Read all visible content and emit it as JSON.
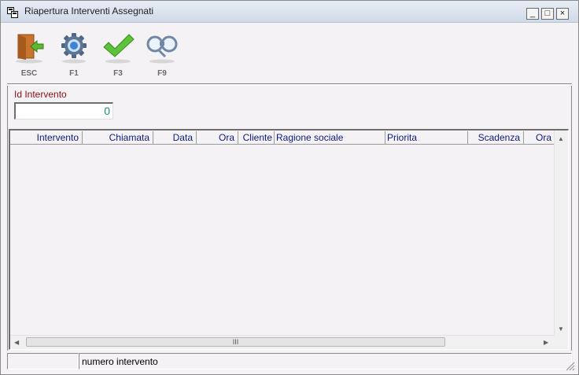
{
  "window": {
    "title": "Riapertura Interventi Assegnati",
    "controls": {
      "minimize": "_",
      "maximize": "□",
      "close": "×"
    }
  },
  "toolbar": {
    "buttons": [
      {
        "label": "ESC",
        "icon": "exit-door-icon"
      },
      {
        "label": "F1",
        "icon": "gear-icon"
      },
      {
        "label": "F3",
        "icon": "checkmark-icon"
      },
      {
        "label": "F9",
        "icon": "binoculars-icon"
      }
    ]
  },
  "form": {
    "id_intervento": {
      "label": "Id Intervento",
      "value": "0"
    }
  },
  "grid": {
    "columns": [
      "Intervento",
      "Chiamata",
      "Data",
      "Ora",
      "Cliente",
      "Ragione sociale",
      "Priorita",
      "Scadenza",
      "Ora"
    ],
    "rows": [],
    "scrollbar_grip": "III"
  },
  "statusbar": {
    "left": "",
    "message": "numero intervento"
  },
  "colors": {
    "label_red": "#8b1010",
    "header_blue": "#0a1a80",
    "value_teal": "#1b8a7a",
    "background": "#f5f2f5"
  }
}
